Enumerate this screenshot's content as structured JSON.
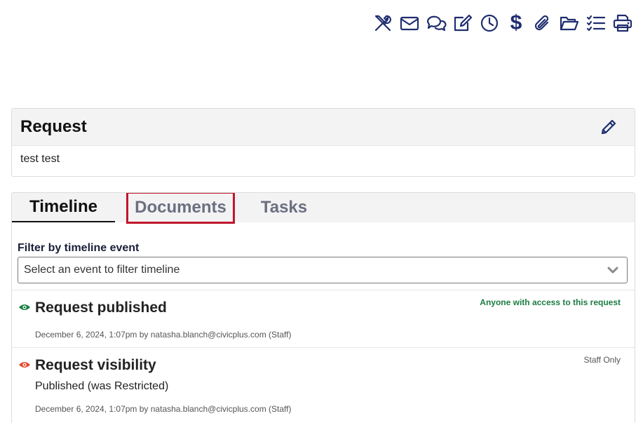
{
  "toolbar": {
    "icons": [
      "tools-icon",
      "mail-icon",
      "chat-icon",
      "edit-note-icon",
      "clock-icon",
      "dollar-icon",
      "attachment-icon",
      "folder-icon",
      "checklist-icon",
      "print-icon"
    ],
    "dollar_glyph": "$",
    "icon_color": "#1f2d6f"
  },
  "request": {
    "title": "Request",
    "body": "test test"
  },
  "tabs": [
    {
      "label": "Timeline",
      "active": true
    },
    {
      "label": "Documents",
      "highlighted": true
    },
    {
      "label": "Tasks"
    }
  ],
  "filter": {
    "label": "Filter by timeline event",
    "selected": "Select an event to filter timeline"
  },
  "events": [
    {
      "title": "Request published",
      "access": "Anyone with access to this request",
      "access_color": "#1a7d42",
      "meta": "December 6, 2024, 1:07pm by natasha.blanch@civicplus.com (Staff)",
      "icon_color": "#1a7d42"
    },
    {
      "title": "Request visibility",
      "access": "Staff Only",
      "access_color": "#555555",
      "detail": "Published (was Restricted)",
      "meta": "December 6, 2024, 1:07pm by natasha.blanch@civicplus.com (Staff)",
      "icon_color": "#e04a2f"
    }
  ],
  "colors": {
    "highlight_border": "#c0162c",
    "tab_inactive": "#6b6f80"
  }
}
